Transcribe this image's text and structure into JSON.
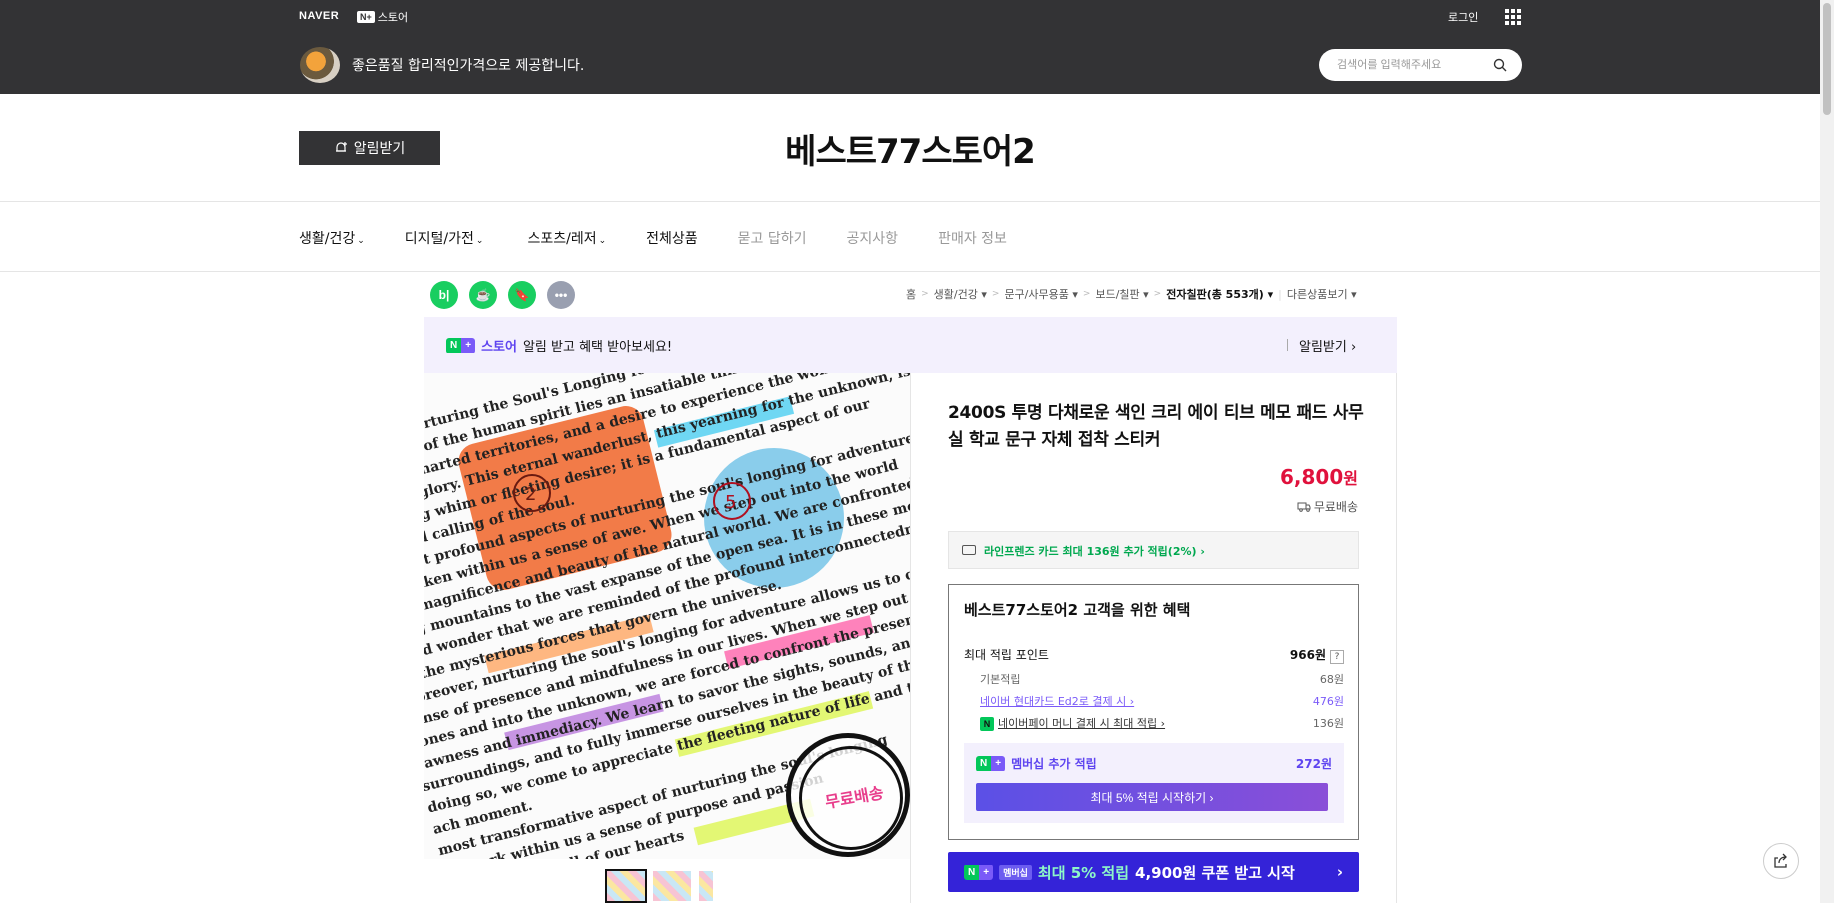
{
  "header": {
    "naver_logo": "NAVER",
    "nplus_box": "N+",
    "nplus_store": "스토어",
    "login": "로그인",
    "slogan": "좋은품질 합리적인가격으로 제공합니다.",
    "search_placeholder": "검색어를 입력해주세요"
  },
  "store": {
    "alarm_button": "알림받기",
    "title": "베스트77스토어2"
  },
  "menu": [
    {
      "label": "생활/건강",
      "chevron": "⌄",
      "dim": false
    },
    {
      "label": "디지털/가전",
      "chevron": "⌄",
      "dim": false
    },
    {
      "label": "스포츠/레저",
      "chevron": "⌄",
      "dim": false
    },
    {
      "label": "전체상품",
      "chevron": "",
      "dim": false
    },
    {
      "label": "묻고 답하기",
      "chevron": "",
      "dim": true
    },
    {
      "label": "공지사항",
      "chevron": "",
      "dim": true
    },
    {
      "label": "판매자 정보",
      "chevron": "",
      "dim": true
    }
  ],
  "icon_buttons": [
    {
      "icon": "blog-icon",
      "glyph": "b|",
      "color": "#19ce60"
    },
    {
      "icon": "cafe-icon",
      "glyph": "☕",
      "color": "#19ce60"
    },
    {
      "icon": "bookmark-icon",
      "glyph": "🔖",
      "color": "#19ce60"
    },
    {
      "icon": "more-icon",
      "glyph": "•••",
      "color": "#999fb0"
    }
  ],
  "breadcrumb": {
    "home": "홈",
    "cat1": "생활/건강",
    "cat2": "문구/사무용품",
    "cat3": "보드/칠판",
    "cat4": "전자칠판(총 553개)",
    "other": "다른상품보기"
  },
  "banner": {
    "store_word": "스토어",
    "message": "알림 받고 혜택 받아보세요!",
    "right": "알림받기 ›"
  },
  "product": {
    "name": "2400S 투명 다채로운 색인 크리 에이 티브 메모 패드 사무실 학교 문구 자체 접착 스티커",
    "price": "6,800",
    "price_unit": "원",
    "shipping": "무료배송",
    "card_benefit": "라인프렌즈 카드 최대 136원 추가 적립(2%) ›",
    "stamp_text": "무료배송"
  },
  "benefits": {
    "title": "베스트77스토어2 고객을 위한 혜택",
    "max_points_label": "최대 적립 포인트",
    "max_points_value": "966원",
    "qmark": "?",
    "basic_label": "기본적립",
    "basic_value": "68원",
    "card_label": "네이버 현대카드 Ed2로 결제 시 ›",
    "card_value": "476원",
    "npay_badge": "N",
    "npay_label": "네이버페이 머니 결제 시 최대 적립 ›",
    "npay_value": "136원",
    "member_label": "멤버십 추가 적립",
    "member_value": "272원",
    "member_button": "최대 5% 적립 시작하기 ›"
  },
  "promo": {
    "membership_tag": "멤버십",
    "text_a": "최대 5% 적립",
    "text_b": "4,900원 쿠폰 받고 시작",
    "arrow": "›"
  },
  "image_text": {
    "lines": [
      "derlust: Nurturing the Soul's Longing for Adventure",
      "n a recess of the human spirit lies an insatiable thirst for adventure",
      "plore uncharted territories, and a desire to experience the wonders of",
      "all their glory. This eternal wanderlust, this yearning for the unknown, is",
      "a passing whim or fleeting desire; it is a fundamental aspect of our",
      "a sacred calling of the soul.",
      "he most profound aspects of nurturing the soul's longing for adventure is its",
      "to awaken within us a sense of awe. When we step out into the world",
      "heer magnificence and beauty of the natural world. We are confronted with",
      "ering mountains to the vast expanse of the open sea. It is in these moments of",
      "e and wonder that we are reminded of the profound interconnectedness of all life",
      "nd the mysterious forces that govern the universe.",
      "Moreover, nurturing the soul's longing for adventure allows us to cultivate a deep",
      "sense of presence and mindfulness in our lives. When we step out of our comfort",
      "zones and into the unknown, we are forced to confront the present moment in",
      "rawness and immediacy. We learn to savor the sights, sounds, and sensations",
      "surroundings, and to fully immerse ourselves in the beauty of the here and now.",
      "doing so, we come to appreciate the fleeting nature of life and the precious",
      "ach moment.",
      "most transformative aspect of nurturing the soul's longing",
      "to spark within us a sense of purpose and passion",
      "and heed the call of our hearts"
    ],
    "note_orange_number": "2",
    "note_blue_number": "5"
  },
  "colors": {
    "topbar": "#333335",
    "price": "#e0113c",
    "naver_green": "#03c75a",
    "membership_purple": "#7a5af8",
    "promo_blue": "#3423d8"
  }
}
